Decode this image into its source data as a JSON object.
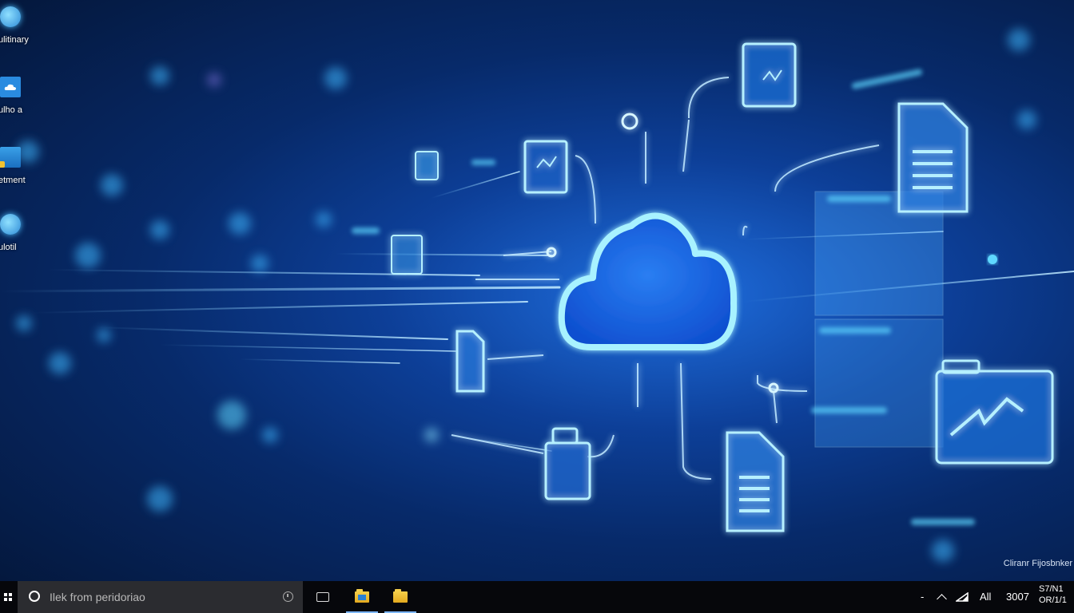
{
  "desktop": {
    "icons": [
      {
        "label": "ulitinary",
        "icon": "globe-icon"
      },
      {
        "label": "ulho a",
        "icon": "cloud-icon"
      },
      {
        "label": "etment",
        "icon": "folder-icon"
      },
      {
        "label": "ulotil",
        "icon": "globe-icon"
      }
    ],
    "watermark": "Cliranr Fijosbnker"
  },
  "taskbar": {
    "search_placeholder": "Ilek from peridoriao",
    "pinned": [
      "task-view-icon",
      "file-explorer-icon",
      "folder-icon"
    ],
    "tray": {
      "separator": "-",
      "network_label": "All",
      "number": "3007",
      "clock_line1": "S7/N1",
      "clock_line2": "OR/1/1"
    }
  },
  "colors": {
    "accent": "#3ac8ff",
    "background": "#0a3070",
    "taskbar": "#06070b",
    "search": "#2b2c30"
  }
}
